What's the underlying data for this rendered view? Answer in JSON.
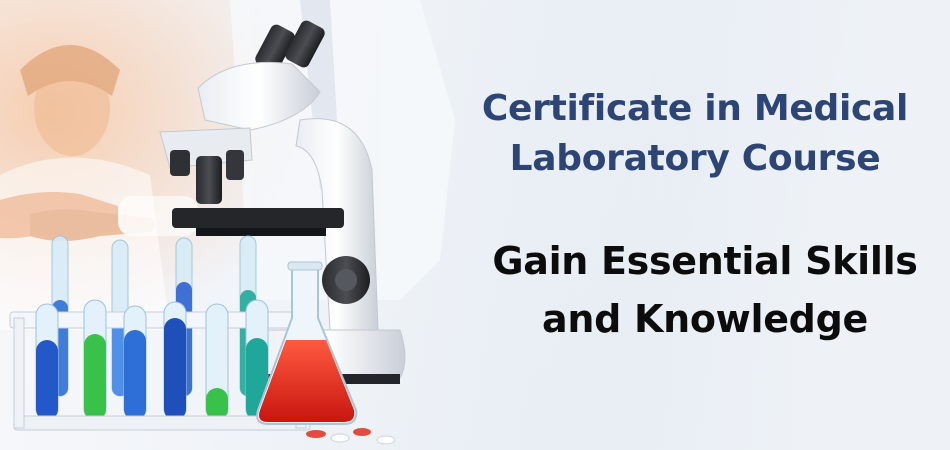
{
  "banner": {
    "headline_lines": [
      "Certificate in Medical",
      "Laboratory Course"
    ],
    "tagline_lines": [
      "Gain Essential Skills",
      "and Knowledge"
    ]
  },
  "colors": {
    "headline": "#2c4574",
    "tagline": "#0c0c0c",
    "background": "#eef2f7",
    "liquid_blue": "#2d6fd6",
    "liquid_green": "#39c24a",
    "liquid_red": "#e32b1f",
    "liquid_teal": "#1fa89a"
  },
  "icons": [
    "microscope-icon",
    "test-tube-rack-icon",
    "erlenmeyer-flask-icon",
    "handshake-icon",
    "lab-worker-silhouette"
  ]
}
